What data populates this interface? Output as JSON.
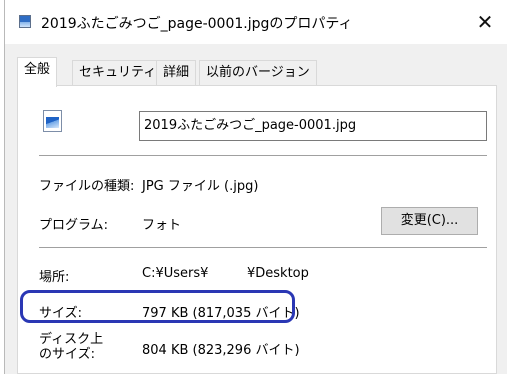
{
  "window": {
    "title": "2019ふたごみつご_page-0001.jpgのプロパティ",
    "close_glyph": "✕"
  },
  "tabs": [
    {
      "label": "全般",
      "active": true
    },
    {
      "label": "セキュリティ",
      "active": false
    },
    {
      "label": "詳細",
      "active": false
    },
    {
      "label": "以前のバージョン",
      "active": false
    }
  ],
  "general": {
    "file_name": "2019ふたごみつご_page-0001.jpg",
    "file_type_label": "ファイルの種類:",
    "file_type_value": "JPG ファイル (.jpg)",
    "program_label": "プログラム:",
    "program_value": "フォト",
    "change_button": "変更(C)...",
    "location_label": "場所:",
    "location_user": "C:¥Users¥",
    "location_folder": "¥Desktop",
    "size_label": "サイズ:",
    "size_value": "797 KB (817,035 バイト)",
    "disk_size_label_line1": "ディスク上",
    "disk_size_label_line2": "のサイズ:",
    "disk_size_value": "804 KB (823,296 バイト)"
  },
  "icons": {
    "title": "image-file-icon",
    "file": "image-file-icon"
  },
  "colors": {
    "highlight": "#2a37b4"
  }
}
